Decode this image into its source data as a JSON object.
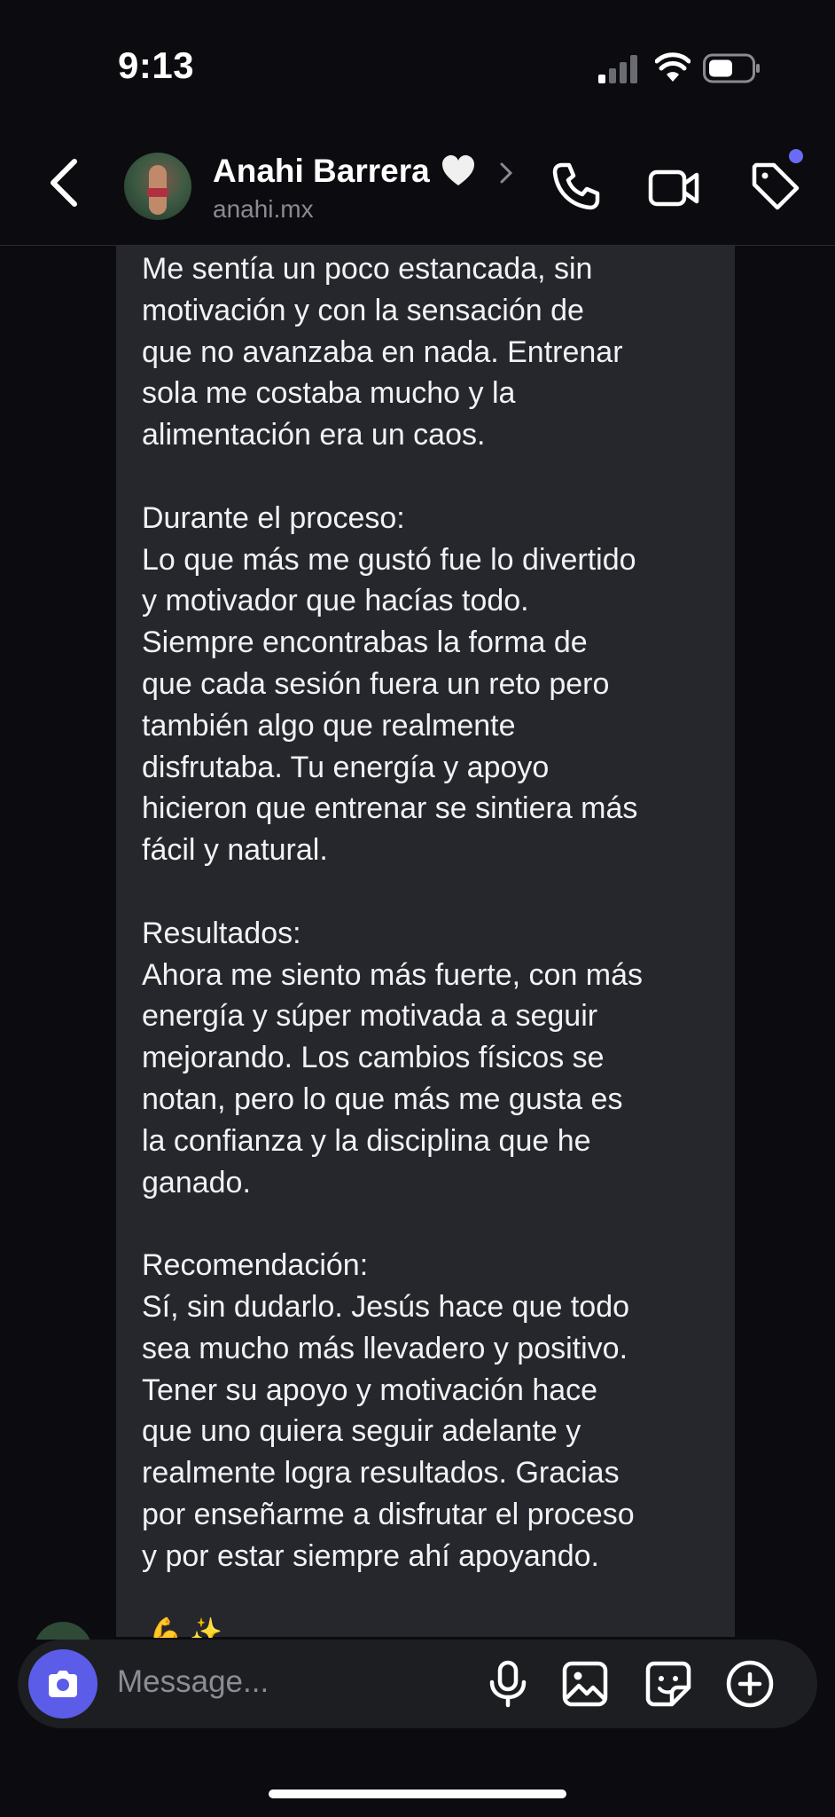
{
  "status_bar": {
    "time": "9:13"
  },
  "header": {
    "name": "Anahi Barrera",
    "username": "anahi.mx",
    "icons": [
      "back-chevron-icon",
      "white-heart-icon",
      "chevron-right-icon",
      "phone-icon",
      "video-camera-icon",
      "tag-icon"
    ],
    "notification_dot_color": "#6a6cf6"
  },
  "message": {
    "text": "Me sentía un poco estancada, sin\nmotivación y con la sensación de\nque no avanzaba en nada. Entrenar\nsola me costaba mucho y la\nalimentación era un caos.\n\nDurante el proceso:\nLo que más me gustó fue lo divertido\ny motivador que hacías todo.\nSiempre encontrabas la forma de\nque cada sesión fuera un reto pero\ntambién algo que realmente\ndisfrutaba. Tu energía y apoyo\nhicieron que entrenar se sintiera más\nfácil y natural.\n\nResultados:\nAhora me siento más fuerte, con más\nenergía y súper motivada a seguir\nmejorando. Los cambios físicos se\nnotan, pero lo que más me gusta es\nla confianza y la disciplina que he\nganado.\n\nRecomendación:\nSí, sin dudarlo. Jesús hace que todo\nsea mucho más llevadero y positivo.\nTener su apoyo y motivación hace\nque uno quiera seguir adelante y\nrealmente logra resultados. Gracias\npor enseñarme a disfrutar el proceso\ny por estar siempre ahí apoyando.",
    "trailing_emoji": "💪 ✨",
    "bubble_color": "#26272c"
  },
  "composer": {
    "placeholder": "Message...",
    "camera_button_color": "#5b5de8",
    "icons": [
      "camera-icon",
      "microphone-icon",
      "gallery-icon",
      "sticker-icon",
      "plus-icon"
    ]
  }
}
